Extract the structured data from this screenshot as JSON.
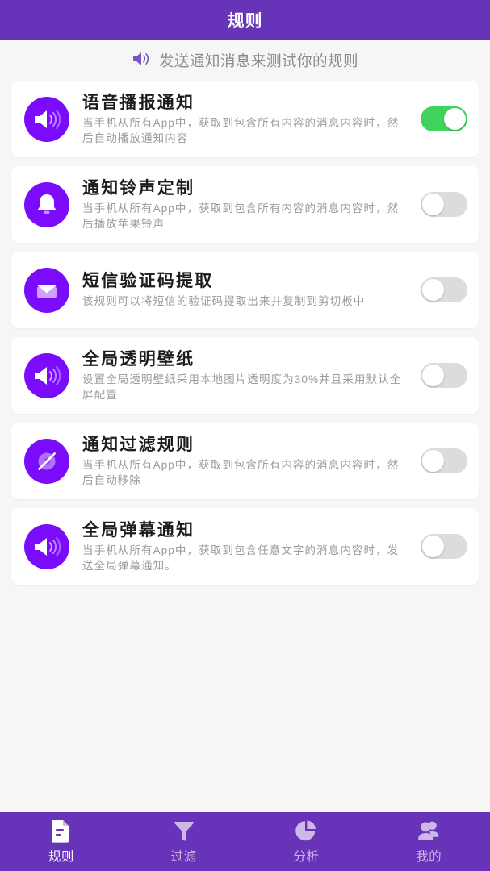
{
  "header": {
    "title": "规则"
  },
  "test_hint": {
    "icon": "speaker-icon",
    "text": "发送通知消息来测试你的规则"
  },
  "colors": {
    "brand_purple": "#6633b9",
    "icon_purple": "#7a0cfb",
    "toggle_on_green": "#3fd35c",
    "toggle_off_gray": "#dcdcde",
    "card_white": "#ffffff",
    "page_background": "#f6f6f7",
    "title_text": "#1c1c1e",
    "desc_text": "#9a9aa0"
  },
  "rules": [
    {
      "icon": "speaker-icon",
      "title": "语音播报通知",
      "desc": "当手机从所有App中，获取到包含所有内容的消息内容时，然后自动播放通知内容",
      "enabled": true,
      "toggle_state": "on"
    },
    {
      "icon": "bell-icon",
      "title": "通知铃声定制",
      "desc": "当手机从所有App中，获取到包含所有内容的消息内容时，然后播放苹果铃声",
      "enabled": false,
      "toggle_state": "off"
    },
    {
      "icon": "envelope-icon",
      "title": "短信验证码提取",
      "desc": "该规则可以将短信的验证码提取出来并复制到剪切板中",
      "enabled": false,
      "toggle_state": "off"
    },
    {
      "icon": "speaker-icon",
      "title": "全局透明壁纸",
      "desc": "设置全局透明壁纸采用本地图片透明度为30%并且采用默认全屏配置",
      "enabled": false,
      "toggle_state": "off"
    },
    {
      "icon": "slashed-circle-icon",
      "title": "通知过滤规则",
      "desc": "当手机从所有App中，获取到包含所有内容的消息内容时，然后自动移除",
      "enabled": false,
      "toggle_state": "off"
    },
    {
      "icon": "speaker-icon",
      "title": "全局弹幕通知",
      "desc": "当手机从所有App中，获取到包含任意文字的消息内容时，发送全局弹幕通知。",
      "enabled": false,
      "toggle_state": "off"
    }
  ],
  "tabs": [
    {
      "label": "规则",
      "icon": "document-icon",
      "active": true
    },
    {
      "label": "过滤",
      "icon": "funnel-icon",
      "active": false
    },
    {
      "label": "分析",
      "icon": "pie-chart-icon",
      "active": false
    },
    {
      "label": "我的",
      "icon": "people-icon",
      "active": false
    }
  ]
}
